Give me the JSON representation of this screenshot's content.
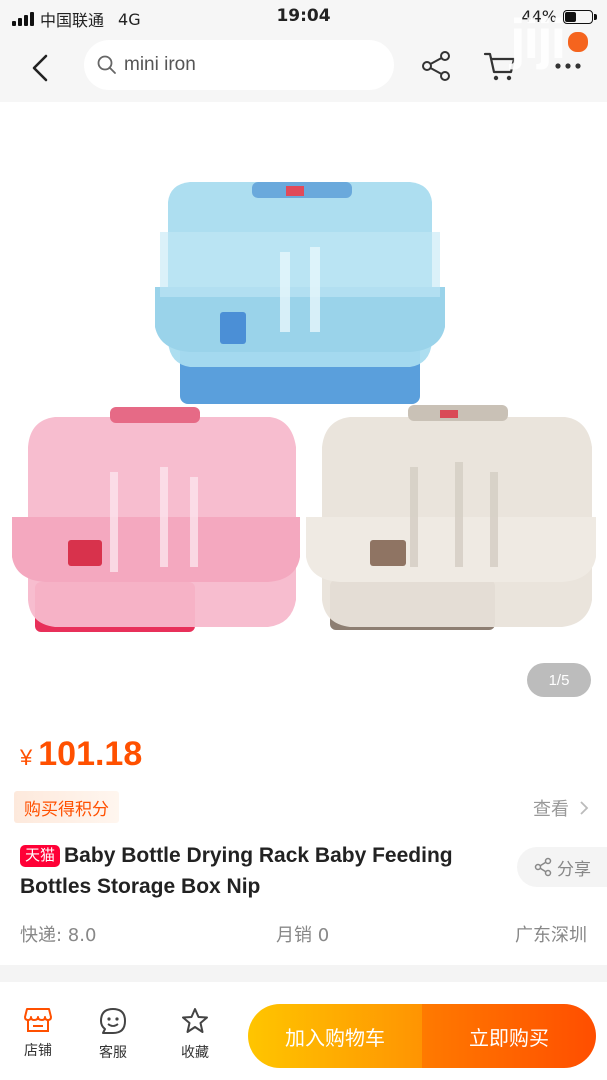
{
  "status_bar": {
    "carrier": "中国联通",
    "network": "4G",
    "time": "19:04",
    "battery": "44%",
    "battery_level": 0.44
  },
  "nav": {
    "search_text": "mini iron",
    "icons": [
      "back-icon",
      "search-icon",
      "share-icon",
      "cart-icon",
      "more-icon"
    ]
  },
  "gallery": {
    "counter": "1/5",
    "watermark": "jiji",
    "product_colors": [
      "#a9dcef",
      "#f7b9cc",
      "#e9e3da"
    ]
  },
  "product": {
    "currency": "¥",
    "price": "101.18",
    "points_label": "购买得积分",
    "view_label": "查看",
    "store_badge": "天猫",
    "title": "Baby Bottle Drying Rack Baby Feeding Bottles Storage Box Nip",
    "share_label": "分享",
    "shipping": "快递: 8.0",
    "monthly_sales": "月销 0",
    "location": "广东深圳"
  },
  "bottom_bar": {
    "tabs": [
      {
        "label": "店铺",
        "icon": "store-icon"
      },
      {
        "label": "客服",
        "icon": "customer-service-icon"
      },
      {
        "label": "收藏",
        "icon": "favorite-star-icon"
      }
    ],
    "add_to_cart": "加入购物车",
    "buy_now": "立即购买"
  },
  "colors": {
    "accent": "#ff5000",
    "tmall_red": "#ff0036",
    "cart_yellow": "#ffa500"
  }
}
